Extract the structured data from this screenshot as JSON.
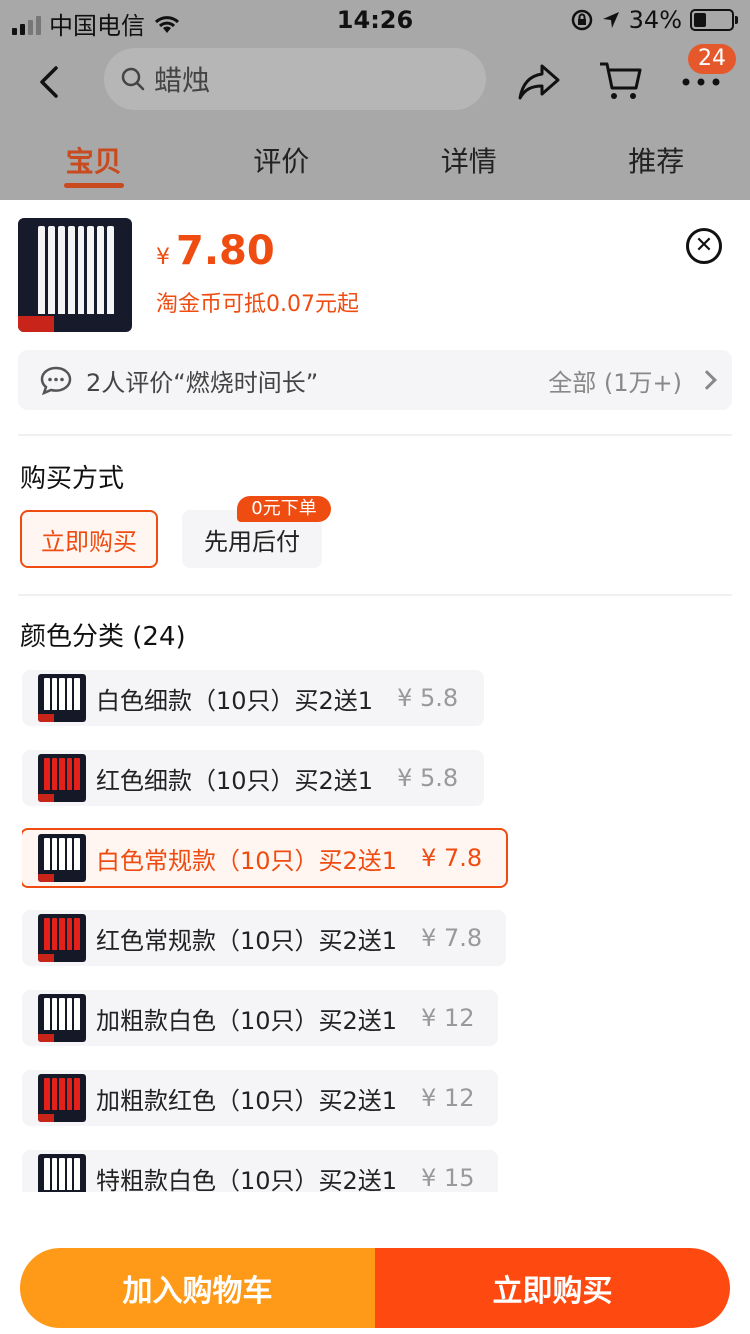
{
  "status_bar": {
    "carrier": "中国电信",
    "time": "14:26",
    "battery": "34%"
  },
  "nav": {
    "search_value": "蜡烛",
    "cart_badge": "24"
  },
  "tabs": [
    {
      "label": "宝贝",
      "active": true
    },
    {
      "label": "评价",
      "active": false
    },
    {
      "label": "详情",
      "active": false
    },
    {
      "label": "推荐",
      "active": false
    }
  ],
  "product": {
    "price_symbol": "¥",
    "price": "7.80",
    "coin_text": "淘金币可抵0.07元起"
  },
  "review": {
    "text": "2人评价“燃烧时间长”",
    "all_label": "全部 (1万+)"
  },
  "purchase": {
    "title": "购买方式",
    "options": [
      "立即购买",
      "先用后付"
    ],
    "badge": "0元下单"
  },
  "color": {
    "title": "颜色分类 (24)",
    "items": [
      {
        "name": "白色细款（10只）买2送1",
        "price": "¥ 5.8",
        "candle": "#ffffff"
      },
      {
        "name": "红色细款（10只）买2送1",
        "price": "¥ 5.8",
        "candle": "#e3201a"
      },
      {
        "name": "白色常规款（10只）买2送1",
        "price": "¥ 7.8",
        "candle": "#ffffff"
      },
      {
        "name": "红色常规款（10只）买2送1",
        "price": "¥ 7.8",
        "candle": "#e3201a"
      },
      {
        "name": "加粗款白色（10只）买2送1",
        "price": "¥ 12",
        "candle": "#ffffff"
      },
      {
        "name": "加粗款红色（10只）买2送1",
        "price": "¥ 12",
        "candle": "#e3201a"
      },
      {
        "name": "特粗款白色（10只）买2送1",
        "price": "¥ 15",
        "candle": "#ffffff"
      }
    ],
    "selected_index": 2
  },
  "buttons": {
    "add_cart": "加入购物车",
    "buy_now": "立即购买"
  },
  "colors": {
    "accent": "#ef4c12",
    "cart_orange": "#fe9a17",
    "buy_red": "#fe4a10"
  }
}
